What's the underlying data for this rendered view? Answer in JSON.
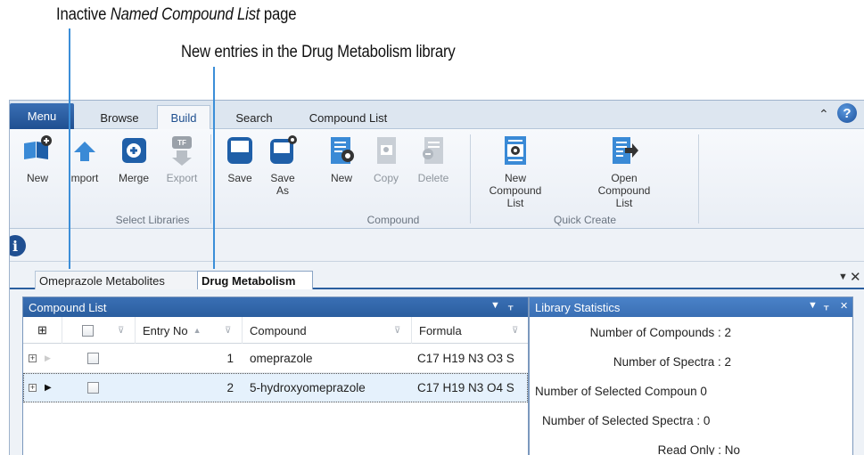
{
  "callouts": {
    "first": {
      "text_plain": "Inactive ",
      "text_italic": "Named Compound List",
      "text_tail": " page"
    },
    "second": {
      "text": "New entries in the Drug Metabolism library"
    }
  },
  "ribbon_tabs": {
    "menu": "Menu",
    "tabs": [
      "Browse",
      "Build",
      "Search",
      "Compound List"
    ],
    "active": "Build"
  },
  "ribbon": {
    "buttons": {
      "new": "New",
      "import": "mport",
      "merge": "Merge",
      "export": "Export",
      "save": "Save",
      "save_as": "Save\nAs",
      "compound_new": "New",
      "copy": "Copy",
      "delete": "Delete",
      "new_compound_list": "New Compound\nList",
      "open_compound_list": "Open Compound\nList"
    },
    "groups": {
      "select_libraries": "Select Libraries",
      "compound": "Compound",
      "quick_create": "Quick Create"
    }
  },
  "doc_tabs": {
    "inactive": "Omeprazole Metabolites",
    "active": "Drug Metabolism"
  },
  "compound_list": {
    "title": "Compound List",
    "columns": {
      "entry_no": "Entry No",
      "compound": "Compound",
      "formula": "Formula"
    },
    "rows": [
      {
        "entry_no": "1",
        "compound": "omeprazole",
        "formula": "C17 H19 N3 O3 S"
      },
      {
        "entry_no": "2",
        "compound": "5-hydroxyomeprazole",
        "formula": "C17 H19 N3 O4 S"
      }
    ]
  },
  "library_statistics": {
    "title": "Library Statistics",
    "items": [
      {
        "label": "Number of Compounds :",
        "value": "2"
      },
      {
        "label": "Number of Spectra :",
        "value": "2"
      },
      {
        "label": "Number of Selected Compoun",
        "value": "0"
      },
      {
        "label": "Number of Selected Spectra :",
        "value": "0"
      },
      {
        "label": "Read Only :",
        "value": "No"
      }
    ]
  },
  "colors": {
    "accent": "#2a5e9f",
    "callout_line": "#3b8ed8",
    "selected_row": "#e5f1fc"
  },
  "icons": [
    "new-library-icon",
    "import-icon",
    "merge-icon",
    "export-icon",
    "save-icon",
    "save-as-icon",
    "new-compound-icon",
    "copy-compound-icon",
    "delete-compound-icon",
    "new-compound-list-icon",
    "open-compound-list-icon",
    "info-icon",
    "help-icon"
  ]
}
